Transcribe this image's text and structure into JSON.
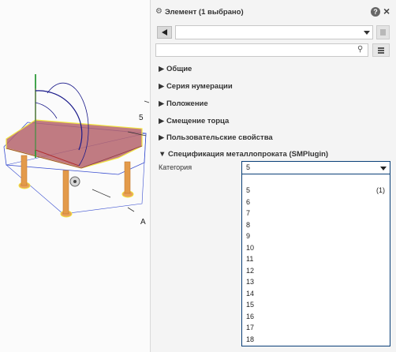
{
  "viewport": {
    "labels": {
      "top_label": "5",
      "bottom_label": "A"
    }
  },
  "panel": {
    "title": "Элемент (1 выбрано)",
    "help_icon_text": "?",
    "close_text": "×",
    "combo_value": "",
    "search_value": "",
    "sections": [
      {
        "label": "▶ Общие"
      },
      {
        "label": "▶ Серия нумерации"
      },
      {
        "label": "▶ Положение"
      },
      {
        "label": "▶ Смещение торца"
      },
      {
        "label": "▶ Пользовательские свойства"
      },
      {
        "label": "▼ Спецификация металлопроката (SMPlugin)"
      }
    ],
    "category": {
      "label": "Категория",
      "value": "5",
      "options": [
        {
          "label": "5",
          "count": "(1)"
        },
        {
          "label": "6"
        },
        {
          "label": "7"
        },
        {
          "label": "8"
        },
        {
          "label": "9"
        },
        {
          "label": "10"
        },
        {
          "label": "11"
        },
        {
          "label": "12"
        },
        {
          "label": "13"
        },
        {
          "label": "14"
        },
        {
          "label": "15"
        },
        {
          "label": "16"
        },
        {
          "label": "17"
        },
        {
          "label": "18"
        }
      ]
    }
  },
  "colors": {
    "accent_border": "#0a3f78",
    "table_top": "#b5646c",
    "legs": "#e39a4a",
    "highlight": "#f2e640"
  }
}
